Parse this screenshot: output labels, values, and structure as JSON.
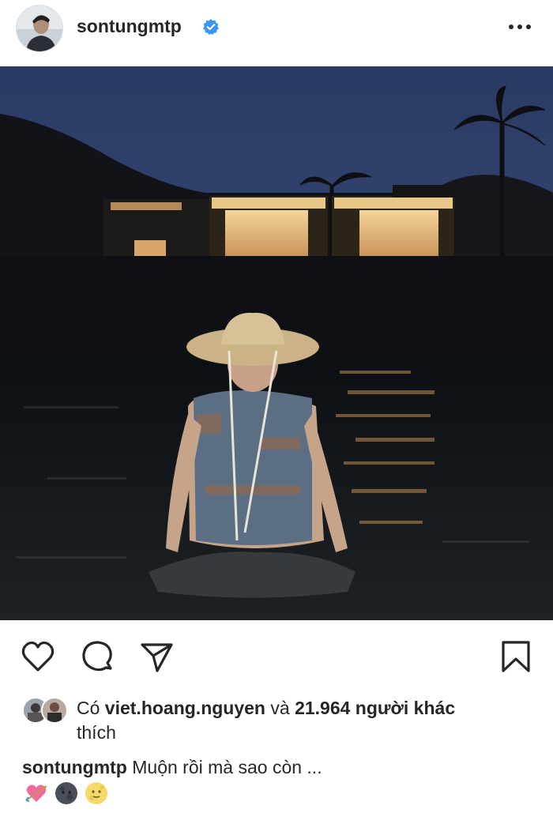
{
  "post": {
    "username": "sontungmtp",
    "verified": true,
    "more_icon": "more-horizontal-icon",
    "image_alt": "Man in straw hat and sunglasses sitting in the sea at night with lit villas behind"
  },
  "actions": {
    "like_icon": "heart-icon",
    "comment_icon": "comment-icon",
    "share_icon": "send-icon",
    "save_icon": "bookmark-icon"
  },
  "likes": {
    "prefix": "Có",
    "user": "viet.hoang.nguyen",
    "conjunction": "và",
    "count_text": "21.964 người khác",
    "suffix": "thích"
  },
  "caption": {
    "username": "sontungmtp",
    "text": "Muộn rồi mà sao còn ...",
    "emojis": [
      "heart-arrow-emoji",
      "new-moon-face-emoji",
      "full-moon-face-emoji"
    ]
  },
  "colors": {
    "text": "#262626",
    "verified": "#3897f0",
    "background": "#ffffff"
  }
}
